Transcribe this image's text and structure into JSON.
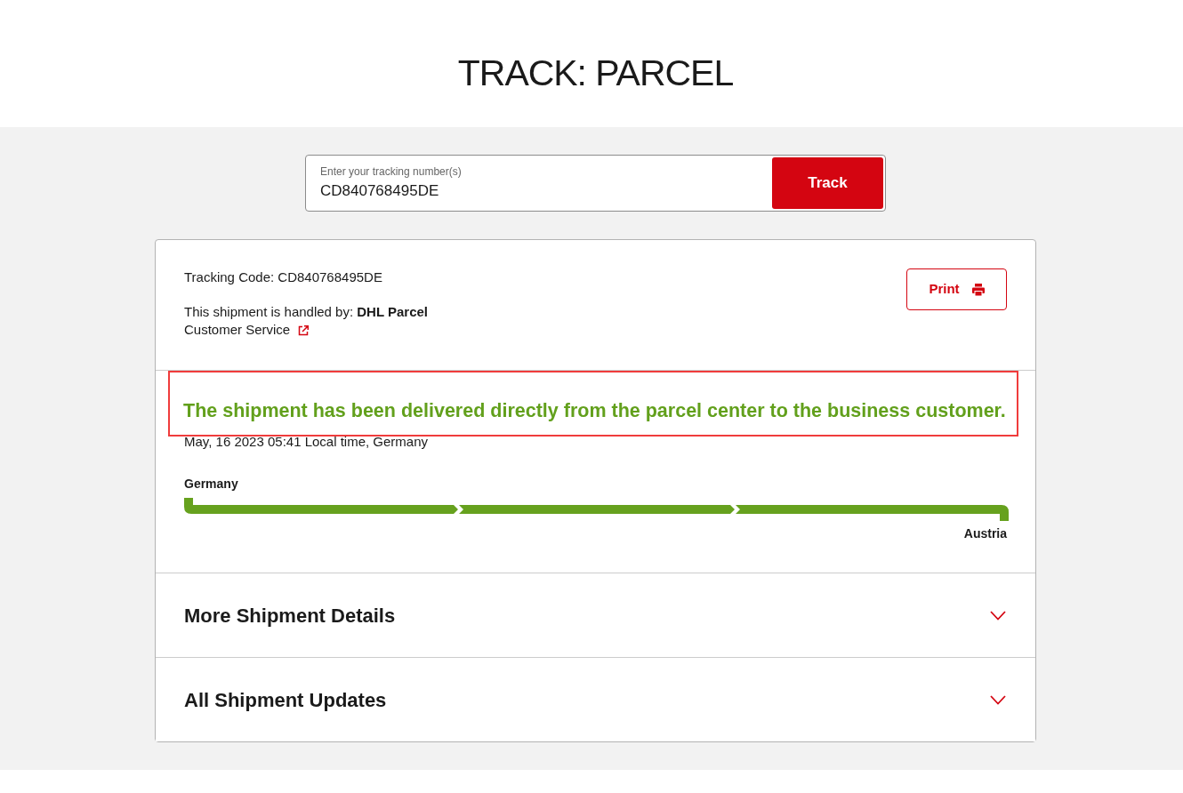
{
  "page_title": "TRACK: PARCEL",
  "search": {
    "label": "Enter your tracking number(s)",
    "value": "CD840768495DE",
    "button": "Track"
  },
  "shipment": {
    "tracking_code": "Tracking Code: CD840768495DE",
    "handler": "This shipment is handled by: **DHL Parcel**",
    "customer_service_link": "Customer Service",
    "print_button": "Print"
  },
  "status": {
    "highlighted": true,
    "message": "The shipment has been delivered directly from the parcel center to the business customer.",
    "timestamp": "May, 16 2023 05:41 Local time, Germany",
    "origin": "Germany",
    "destination": "Austria",
    "route_stages": [
      {
        "complete": true
      },
      {
        "complete": true
      },
      {
        "complete": true
      }
    ]
  },
  "sections": [
    {
      "title": "More Shipment Details",
      "expanded": false
    },
    {
      "title": "All Shipment Updates",
      "expanded": false
    }
  ]
}
